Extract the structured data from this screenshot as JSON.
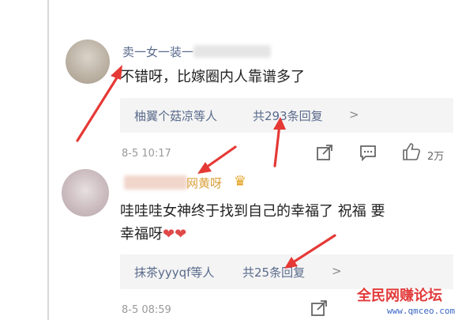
{
  "comment1": {
    "username": "卖一女一装一",
    "text": "不错呀，比嫁圈内人靠谱多了",
    "replies": {
      "names": "柚翼个菇凉等人",
      "count": "共293条回复",
      "chevron": ">"
    },
    "time": "8-5 10:17",
    "likes": "2万"
  },
  "comment2": {
    "username_visible": "网黄呀",
    "crown_glyph": "♛",
    "text_line1": "哇哇哇女神终于找到自己的幸福了 祝福 要",
    "text_line2": "幸福呀",
    "hearts": "❤❤",
    "replies": {
      "names": "抹茶yyyqf等人",
      "count": "共25条回复",
      "chevron": ">"
    },
    "time": "8-5 08:59"
  },
  "watermark": {
    "title": "全民网赚论坛",
    "url": "www.qmceo.com"
  },
  "colors": {
    "arrow": "#e53935",
    "link": "#5a6b8c",
    "accent": "#d9a03b"
  }
}
